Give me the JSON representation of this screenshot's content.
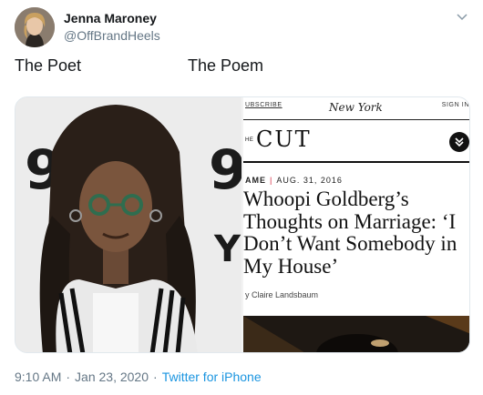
{
  "author": {
    "name": "Jenna Maroney",
    "handle": "@OffBrandHeels"
  },
  "tweet": {
    "text_left": "The Poet",
    "text_right": "The Poem"
  },
  "article": {
    "subscribe": "UBSCRIBE",
    "logo": "New York",
    "sign_in": "SIGN IN",
    "section_prefix": "HE",
    "section": "CUT",
    "category": "AME",
    "date": "AUG. 31, 2016",
    "headline_lines": [
      "Whoopi Goldberg’s",
      "Thoughts on Marriage: ‘I",
      "Don’t Want Somebody in",
      "My House’"
    ],
    "byline": "y Claire Landsbaum"
  },
  "footer": {
    "time": "9:10 AM",
    "date": "Jan 23, 2020",
    "source": "Twitter for iPhone"
  },
  "icons": {
    "caret": "chevron-down-icon",
    "cut_menu": "double-chevron-down-icon"
  },
  "colors": {
    "handle": "#657786",
    "link": "#1b95e0",
    "accent_red": "#d7263d"
  }
}
